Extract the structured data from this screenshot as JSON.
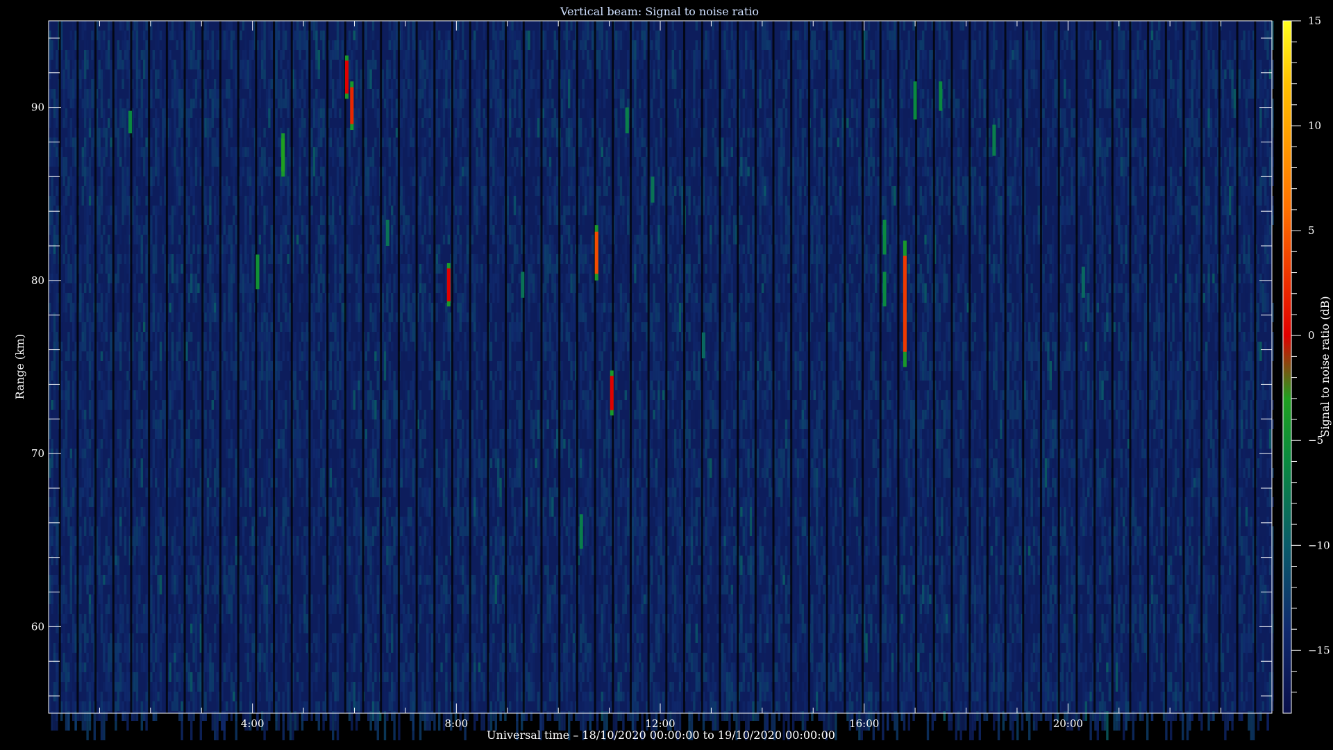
{
  "chart_data": {
    "type": "heatmap",
    "title": "Vertical beam: Signal to noise ratio",
    "xlabel": "Universal time – 18/10/2020 00:00:00 to 19/10/2020 00:00:00",
    "ylabel": "Range (km)",
    "colorbar_label": "Signal to noise ratio (dB)",
    "xlim": [
      0,
      24
    ],
    "ylim": [
      55,
      95
    ],
    "x_ticks": [
      4,
      8,
      12,
      16,
      20
    ],
    "x_tick_labels": [
      "4:00",
      "8:00",
      "12:00",
      "16:00",
      "20:00"
    ],
    "y_ticks": [
      60,
      70,
      80,
      90
    ],
    "y_tick_labels": [
      "60",
      "70",
      "80",
      "90"
    ],
    "clim": [
      -18,
      15
    ],
    "colorbar_ticks": [
      15,
      10,
      5,
      0,
      -5,
      -10,
      -15
    ],
    "colorbar_tick_labels": [
      "15",
      "10",
      "5",
      "0",
      "−5",
      "−10",
      "−15"
    ],
    "colormap": [
      {
        "value": -18,
        "color": "#0a0f4a"
      },
      {
        "value": -14,
        "color": "#102a6e"
      },
      {
        "value": -10,
        "color": "#0a5c6a"
      },
      {
        "value": -6,
        "color": "#0a8a40"
      },
      {
        "value": -3,
        "color": "#20a020"
      },
      {
        "value": 0,
        "color": "#e00000"
      },
      {
        "value": 6,
        "color": "#ff7000"
      },
      {
        "value": 12,
        "color": "#ffc000"
      },
      {
        "value": 15,
        "color": "#ffff20"
      }
    ],
    "background_snr": -16,
    "strong_echoes": [
      {
        "time": 1.6,
        "range_start": 88.5,
        "range_end": 89.8,
        "snr": -6
      },
      {
        "time": 4.1,
        "range_start": 79.5,
        "range_end": 81.5,
        "snr": -5
      },
      {
        "time": 4.6,
        "range_start": 86,
        "range_end": 88.5,
        "snr": -3
      },
      {
        "time": 5.85,
        "range_start": 90.5,
        "range_end": 93,
        "snr": 0
      },
      {
        "time": 5.95,
        "range_start": 88.7,
        "range_end": 91.5,
        "snr": 2
      },
      {
        "time": 6.65,
        "range_start": 82,
        "range_end": 83.5,
        "snr": -8
      },
      {
        "time": 7.85,
        "range_start": 78.5,
        "range_end": 81,
        "snr": 0
      },
      {
        "time": 9.3,
        "range_start": 79,
        "range_end": 80.5,
        "snr": -8
      },
      {
        "time": 10.45,
        "range_start": 64.5,
        "range_end": 66.5,
        "snr": -7
      },
      {
        "time": 10.75,
        "range_start": 80,
        "range_end": 83.2,
        "snr": 4
      },
      {
        "time": 11.05,
        "range_start": 72.2,
        "range_end": 74.8,
        "snr": 0
      },
      {
        "time": 11.35,
        "range_start": 88.5,
        "range_end": 90,
        "snr": -7
      },
      {
        "time": 11.85,
        "range_start": 84.5,
        "range_end": 86,
        "snr": -8
      },
      {
        "time": 12.85,
        "range_start": 75.5,
        "range_end": 77,
        "snr": -9
      },
      {
        "time": 16.4,
        "range_start": 78.5,
        "range_end": 80.5,
        "snr": -6
      },
      {
        "time": 16.4,
        "range_start": 81.5,
        "range_end": 83.5,
        "snr": -6
      },
      {
        "time": 16.8,
        "range_start": 75,
        "range_end": 82.3,
        "snr": 3
      },
      {
        "time": 17.0,
        "range_start": 89.3,
        "range_end": 91.5,
        "snr": -6
      },
      {
        "time": 17.5,
        "range_start": 89.8,
        "range_end": 91.5,
        "snr": -6
      },
      {
        "time": 18.55,
        "range_start": 87.2,
        "range_end": 89,
        "snr": -7
      },
      {
        "time": 20.3,
        "range_start": 79,
        "range_end": 80.8,
        "snr": -9
      }
    ]
  }
}
